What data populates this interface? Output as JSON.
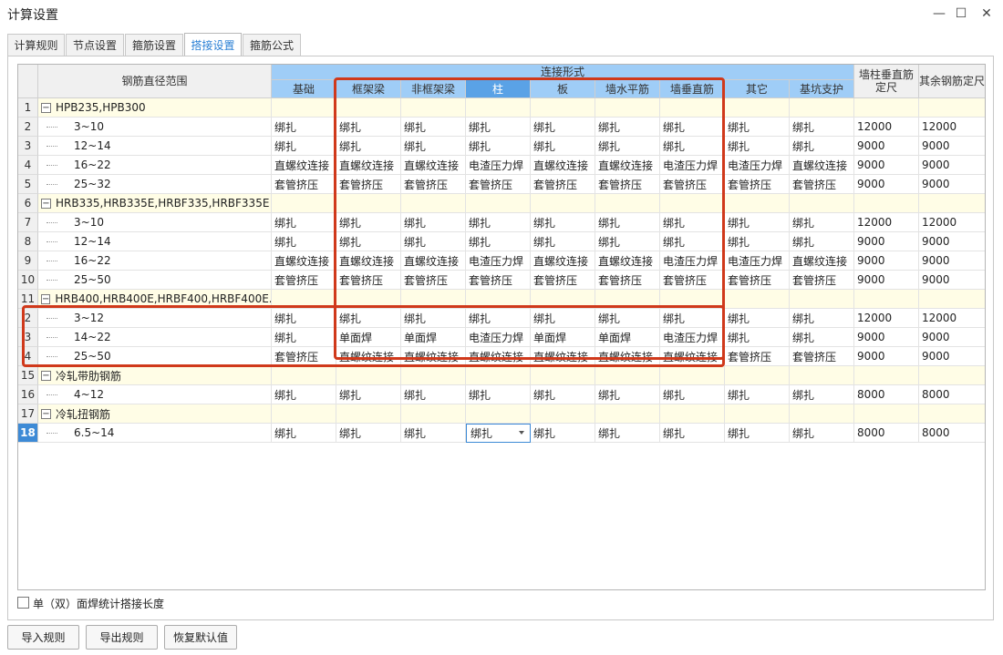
{
  "window": {
    "title": "计算设置"
  },
  "tabs": [
    "计算规则",
    "节点设置",
    "箍筋设置",
    "搭接设置",
    "箍筋公式"
  ],
  "active_tab": "搭接设置",
  "grid": {
    "header": {
      "range_label": "钢筋直径范围",
      "group_label": "连接形式",
      "columns": [
        "基础",
        "框架梁",
        "非框架梁",
        "柱",
        "板",
        "墙水平筋",
        "墙垂直筋",
        "其它",
        "基坑支护"
      ],
      "wall_col_label": "墙柱垂直筋定尺",
      "other_col_label": "其余钢筋定尺",
      "selected_column": "柱"
    },
    "rows": [
      {
        "num": "1",
        "group": true,
        "name": "HPB235,HPB300"
      },
      {
        "num": "2",
        "name": "3~10",
        "values": [
          "绑扎",
          "绑扎",
          "绑扎",
          "绑扎",
          "绑扎",
          "绑扎",
          "绑扎",
          "绑扎",
          "绑扎",
          "12000",
          "12000"
        ]
      },
      {
        "num": "3",
        "name": "12~14",
        "values": [
          "绑扎",
          "绑扎",
          "绑扎",
          "绑扎",
          "绑扎",
          "绑扎",
          "绑扎",
          "绑扎",
          "绑扎",
          "9000",
          "9000"
        ]
      },
      {
        "num": "4",
        "name": "16~22",
        "values": [
          "直螺纹连接",
          "直螺纹连接",
          "直螺纹连接",
          "电渣压力焊",
          "直螺纹连接",
          "直螺纹连接",
          "电渣压力焊",
          "电渣压力焊",
          "直螺纹连接",
          "9000",
          "9000"
        ]
      },
      {
        "num": "5",
        "name": "25~32",
        "values": [
          "套管挤压",
          "套管挤压",
          "套管挤压",
          "套管挤压",
          "套管挤压",
          "套管挤压",
          "套管挤压",
          "套管挤压",
          "套管挤压",
          "9000",
          "9000"
        ]
      },
      {
        "num": "6",
        "group": true,
        "name": "HRB335,HRB335E,HRBF335,HRBF335E"
      },
      {
        "num": "7",
        "name": "3~10",
        "values": [
          "绑扎",
          "绑扎",
          "绑扎",
          "绑扎",
          "绑扎",
          "绑扎",
          "绑扎",
          "绑扎",
          "绑扎",
          "12000",
          "12000"
        ]
      },
      {
        "num": "8",
        "name": "12~14",
        "values": [
          "绑扎",
          "绑扎",
          "绑扎",
          "绑扎",
          "绑扎",
          "绑扎",
          "绑扎",
          "绑扎",
          "绑扎",
          "9000",
          "9000"
        ]
      },
      {
        "num": "9",
        "name": "16~22",
        "values": [
          "直螺纹连接",
          "直螺纹连接",
          "直螺纹连接",
          "电渣压力焊",
          "直螺纹连接",
          "直螺纹连接",
          "电渣压力焊",
          "电渣压力焊",
          "直螺纹连接",
          "9000",
          "9000"
        ]
      },
      {
        "num": "10",
        "name": "25~50",
        "values": [
          "套管挤压",
          "套管挤压",
          "套管挤压",
          "套管挤压",
          "套管挤压",
          "套管挤压",
          "套管挤压",
          "套管挤压",
          "套管挤压",
          "9000",
          "9000"
        ]
      },
      {
        "num": "11",
        "group": true,
        "name": "HRB400,HRB400E,HRBF400,HRBF400E..."
      },
      {
        "num": "2",
        "name": "3~12",
        "values": [
          "绑扎",
          "绑扎",
          "绑扎",
          "绑扎",
          "绑扎",
          "绑扎",
          "绑扎",
          "绑扎",
          "绑扎",
          "12000",
          "12000"
        ]
      },
      {
        "num": "3",
        "name": "14~22",
        "values": [
          "绑扎",
          "单面焊",
          "单面焊",
          "电渣压力焊",
          "单面焊",
          "单面焊",
          "电渣压力焊",
          "绑扎",
          "绑扎",
          "9000",
          "9000"
        ]
      },
      {
        "num": "4",
        "name": "25~50",
        "values": [
          "套管挤压",
          "直螺纹连接",
          "直螺纹连接",
          "直螺纹连接",
          "直螺纹连接",
          "直螺纹连接",
          "直螺纹连接",
          "套管挤压",
          "套管挤压",
          "9000",
          "9000"
        ]
      },
      {
        "num": "15",
        "group": true,
        "name": "冷轧带肋钢筋"
      },
      {
        "num": "16",
        "name": "4~12",
        "values": [
          "绑扎",
          "绑扎",
          "绑扎",
          "绑扎",
          "绑扎",
          "绑扎",
          "绑扎",
          "绑扎",
          "绑扎",
          "8000",
          "8000"
        ]
      },
      {
        "num": "17",
        "group": true,
        "name": "冷轧扭钢筋"
      },
      {
        "num": "18",
        "name": "6.5~14",
        "current": true,
        "values": [
          "绑扎",
          "绑扎",
          "绑扎",
          "绑扎",
          "绑扎",
          "绑扎",
          "绑扎",
          "绑扎",
          "绑扎",
          "8000",
          "8000"
        ]
      }
    ]
  },
  "checkbox_label": "单（双）面焊统计搭接长度",
  "buttons": {
    "import": "导入规则",
    "export": "导出规则",
    "restore": "恢复默认值"
  },
  "colors": {
    "highlight_border": "#d0391b",
    "header_blue": "#9fcdf7",
    "selected_header": "#5aa2e6"
  }
}
